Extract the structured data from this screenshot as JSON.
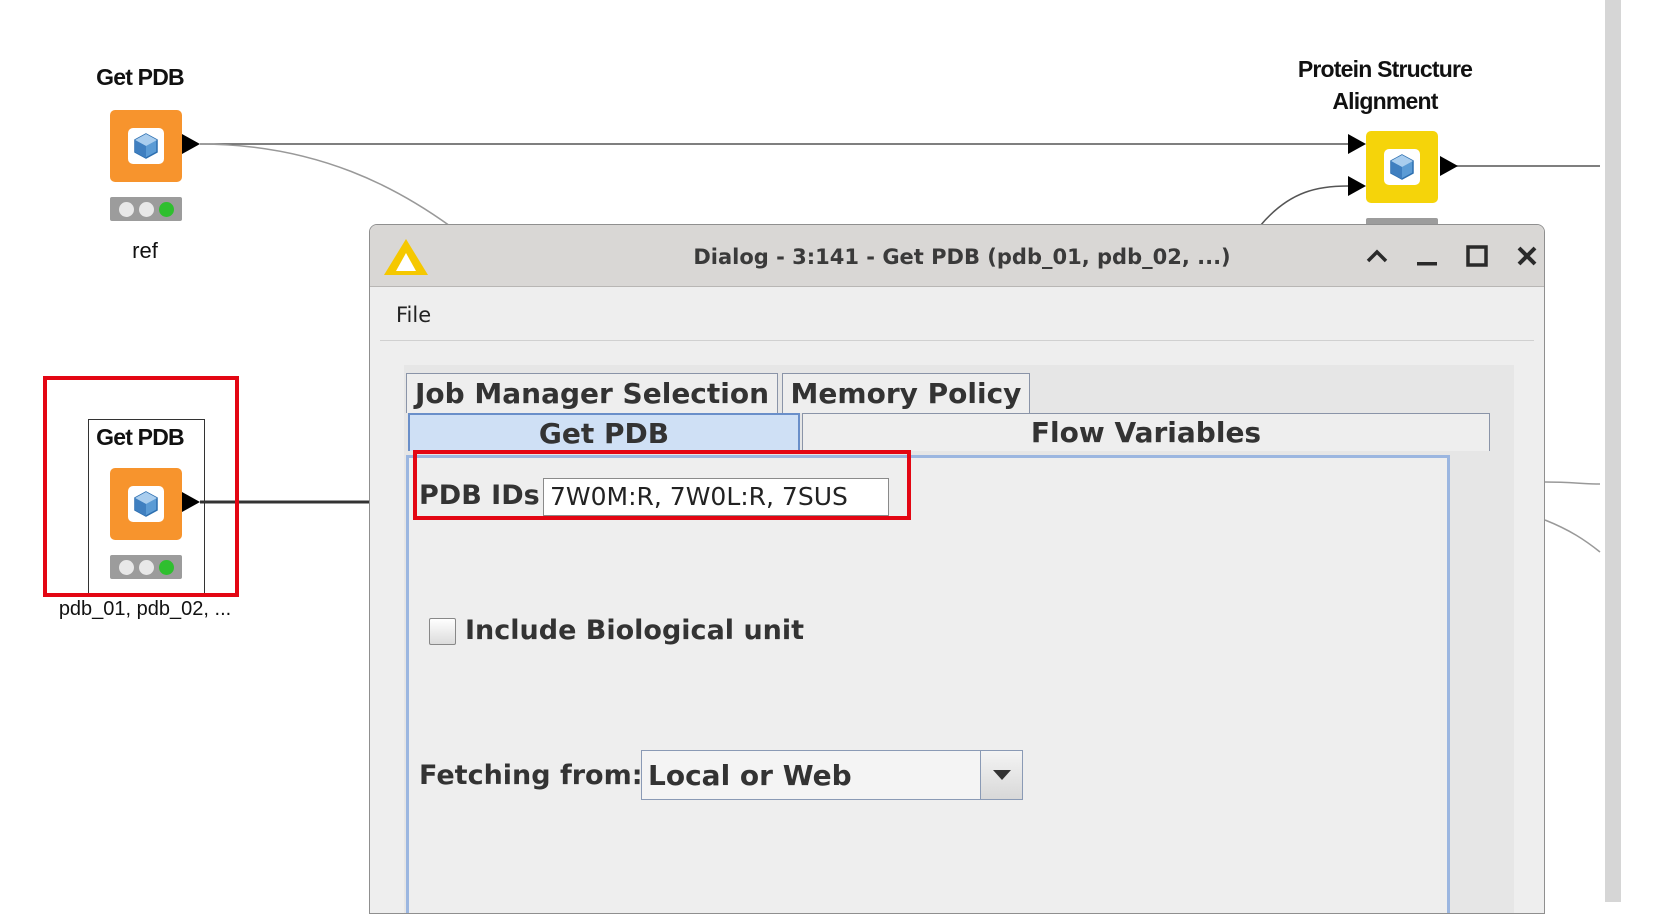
{
  "workflow": {
    "node_ref": {
      "title": "Get PDB",
      "label": "ref"
    },
    "node_pdb": {
      "title": "Get PDB",
      "label": "pdb_01, pdb_02, ..."
    },
    "node_alignment": {
      "title_line1": "Protein Structure",
      "title_line2": "Alignment"
    }
  },
  "dialog": {
    "title": "Dialog - 3:141 - Get PDB (pdb_01, pdb_02, ...)",
    "menu": {
      "file": "File"
    },
    "tabs": {
      "row1": [
        "Job Manager Selection",
        "Memory Policy"
      ],
      "row2": [
        "Get PDB",
        "Flow Variables"
      ],
      "active": "Get PDB"
    },
    "pdb_ids": {
      "label": "PDB IDs",
      "value": "7W0M:R, 7W0L:R, 7SUS"
    },
    "include_bio_unit": {
      "label": "Include Biological unit",
      "checked": false
    },
    "fetching_from": {
      "label": "Fetching from:",
      "value": "Local or Web"
    }
  },
  "icons": {
    "node": "pdb-cube-icon",
    "app": "knime-triangle-icon",
    "title_controls": [
      "chevron-up-icon",
      "minimize-icon",
      "maximize-icon",
      "close-icon"
    ]
  },
  "colors": {
    "node_orange": "#f7942d",
    "node_yellow": "#f5d40a",
    "highlight_red": "#e30613",
    "status_green": "#2fbf2f",
    "active_tab": "#cfe0f5"
  }
}
